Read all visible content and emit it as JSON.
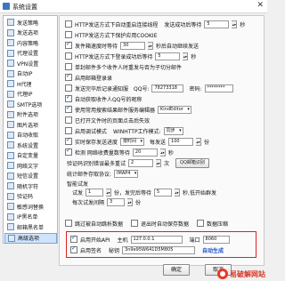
{
  "window": {
    "title": "系统设置",
    "close": "✕"
  },
  "sidebar": {
    "items": [
      {
        "label": "发送策略"
      },
      {
        "label": "发送选项"
      },
      {
        "label": "内容策略"
      },
      {
        "label": "代理设置"
      },
      {
        "label": "VPN设置"
      },
      {
        "label": "自动IP"
      },
      {
        "label": "H代理"
      },
      {
        "label": "代理IP"
      },
      {
        "label": "SMTP选项"
      },
      {
        "label": "附件选项"
      },
      {
        "label": "图片选项"
      },
      {
        "label": "自动收取"
      },
      {
        "label": "系统设置"
      },
      {
        "label": "自定变量"
      },
      {
        "label": "网络文字"
      },
      {
        "label": "短信设置"
      },
      {
        "label": "随机字符"
      },
      {
        "label": "验证码"
      },
      {
        "label": "敏感词替换"
      },
      {
        "label": "IP黑名单"
      },
      {
        "label": "邮箱黑名单"
      },
      {
        "label": "高级选项"
      }
    ],
    "active_index": 21
  },
  "settings": {
    "r1": {
      "label": "HTTP发送方式下自动重启连接线程",
      "label2": "发送成功后等待",
      "value": "5",
      "unit": "秒"
    },
    "r2": {
      "label": "HTTP发送方式下保护应用COOKIE"
    },
    "r3": {
      "label": "发件箱速度时等待",
      "value": "30",
      "unit": "秒后自动继续发送"
    },
    "r4": {
      "label": "HTTP发送方式下登录成功后等待",
      "value": "5",
      "unit": "秒"
    },
    "r5": {
      "label": "单封邮件多个收件人时重发与否为子切分邮件"
    },
    "r6": {
      "label": "启用邮箱登录录"
    },
    "r7": {
      "label": "发送完毕后记录通知服",
      "qq_label": "QQ号:",
      "qq_value": "78273318",
      "pwd_label": "密码:",
      "pwd_value": "********"
    },
    "r8": {
      "label": "自动获取收件人QQ号的昵称"
    },
    "r9": {
      "label": "使用常用搜索结果邮件服务编辑器",
      "select": "KindEditor"
    },
    "r10": {
      "label": "已打开文件时的页面点击后失效"
    },
    "r11": {
      "label": "启用调试模式",
      "label2": "WINHTTP工作模式:",
      "select": "同步"
    },
    "r12": {
      "label": "实时保存发送进度",
      "select": "按时间",
      "label2": "每发送",
      "value": "100",
      "unit": "份"
    },
    "r13": {
      "label": "检测 网络收费量数等待",
      "value": "20",
      "unit": "秒"
    },
    "r14": {
      "label": "验证码识别错误最多重试",
      "value": "2",
      "unit": "次",
      "button": "QQ邮箱识别"
    },
    "r15": {
      "label": "统计邮件存取协议:",
      "select": "IMAP4"
    },
    "smart": {
      "title": "智能试发",
      "t_label": "试发",
      "t_value": "1",
      "t_mid": "份，发完后等待",
      "t_wait": "5",
      "t_unit": "秒,低开始群发",
      "i_label": "每次试发间隔",
      "i_value": "3",
      "i_unit": "份"
    },
    "r16": {
      "label": "跳过被自动跳析数据",
      "label2": "退出时自动保存数据",
      "label3": "数据压缩"
    },
    "api": {
      "label": "启用开始API",
      "host_label": "主机",
      "host": "127.0.0.1",
      "port_label": "端口",
      "port": "8060"
    },
    "sign": {
      "label": "启用签名",
      "key_label": "秘钥",
      "key": "3n9e95W641D5M805",
      "gen": "自动生成"
    }
  },
  "footer": {
    "ok": "确定",
    "cancel": "取消"
  },
  "watermark": {
    "text": "易破解网站"
  }
}
